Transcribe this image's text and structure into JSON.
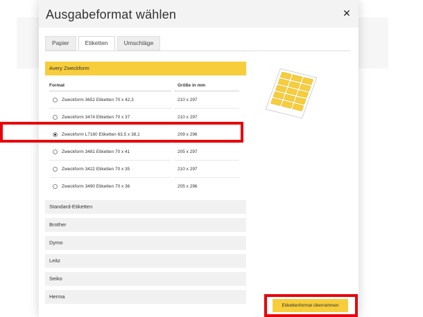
{
  "dialog": {
    "title": "Ausgabeformat wählen",
    "close_icon": "close-icon"
  },
  "tabs": [
    {
      "label": "Papier",
      "active": false
    },
    {
      "label": "Etiketten",
      "active": true
    },
    {
      "label": "Umschläge",
      "active": false
    }
  ],
  "avery": {
    "title": "Avery Zweckform",
    "col_format": "Format",
    "col_size": "Größe in mm",
    "rows": [
      {
        "name": "Zweckform 3652 Etiketten 70 x 42,3",
        "size": "210 x 297",
        "selected": false
      },
      {
        "name": "Zweckform 3474 Etiketten 70 x 37",
        "size": "210 x 297",
        "selected": false
      },
      {
        "name": "Zweckform L7160 Etiketten 63,5 x 38,1",
        "size": "209 x 296",
        "selected": true
      },
      {
        "name": "Zweckform 3481 Etiketten 70 x 41",
        "size": "205 x 297",
        "selected": false
      },
      {
        "name": "Zweckform 3422 Etiketten 70 x 35",
        "size": "210 x 297",
        "selected": false
      },
      {
        "name": "Zweckform 3490 Etiketten 70 x 36",
        "size": "205 x 296",
        "selected": false
      }
    ]
  },
  "sections": [
    {
      "label": "Standard-Etiketten"
    },
    {
      "label": "Brother"
    },
    {
      "label": "Dymo"
    },
    {
      "label": "Leitz"
    },
    {
      "label": "Seiko"
    },
    {
      "label": "Herma"
    }
  ],
  "submit_label": "Etikettenformat übernehmen",
  "colors": {
    "accent": "#f7cd3c",
    "highlight": "#e8000b"
  }
}
